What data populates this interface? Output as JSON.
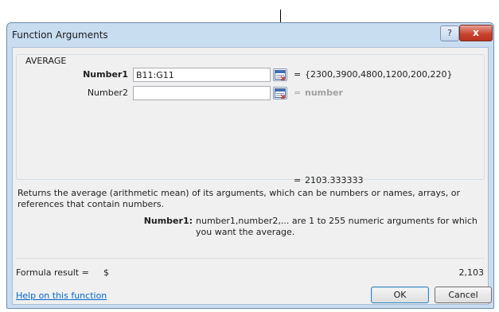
{
  "dialog": {
    "title": "Function Arguments",
    "help_glyph": "?",
    "close_glyph": "x"
  },
  "function": {
    "name": "AVERAGE",
    "args": [
      {
        "label": "Number1",
        "value": "B11:G11",
        "result": "{2300,3900,4800,1200,200,220}",
        "bold": true
      },
      {
        "label": "Number2",
        "value": "",
        "result": "number",
        "bold": false
      }
    ],
    "equals": "=",
    "function_result": "2103.333333",
    "description": "Returns the average (arithmetic mean) of its arguments, which can be numbers or names, arrays, or references that contain numbers.",
    "param_name": "Number1:",
    "param_description": "number1,number2,... are 1 to 255 numeric arguments for which you want the average."
  },
  "formula_result": {
    "label": "Formula result =",
    "currency": "$",
    "value": "2,103"
  },
  "footer": {
    "help_link": "Help on this function",
    "ok_label": "OK",
    "cancel_label": "Cancel"
  },
  "icons": {
    "collapse": "collapse-dialog-icon",
    "help": "help-icon",
    "close": "close-icon"
  },
  "colors": {
    "window_frame": "#c9ddf1",
    "close_button": "#c84530",
    "link": "#0066cc",
    "placeholder_result": "#a0a0a0"
  }
}
